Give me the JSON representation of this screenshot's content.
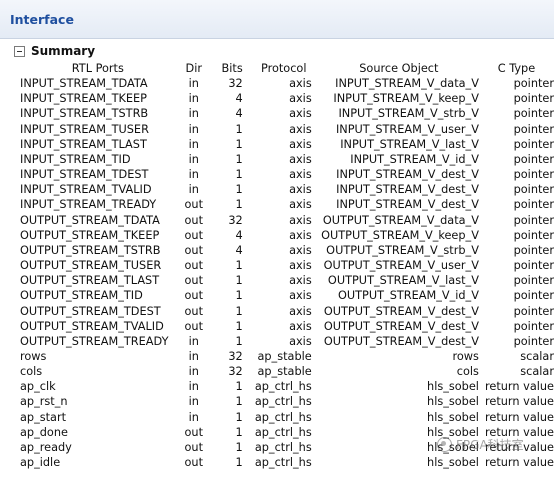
{
  "header": {
    "title": "Interface"
  },
  "summary": {
    "title": "Summary"
  },
  "table": {
    "columns": [
      "RTL Ports",
      "Dir",
      "Bits",
      "Protocol",
      "Source Object",
      "C Type"
    ],
    "rows": [
      [
        "INPUT_STREAM_TDATA",
        "in",
        "32",
        "axis",
        "INPUT_STREAM_V_data_V",
        "pointer"
      ],
      [
        "INPUT_STREAM_TKEEP",
        "in",
        "4",
        "axis",
        "INPUT_STREAM_V_keep_V",
        "pointer"
      ],
      [
        "INPUT_STREAM_TSTRB",
        "in",
        "4",
        "axis",
        "INPUT_STREAM_V_strb_V",
        "pointer"
      ],
      [
        "INPUT_STREAM_TUSER",
        "in",
        "1",
        "axis",
        "INPUT_STREAM_V_user_V",
        "pointer"
      ],
      [
        "INPUT_STREAM_TLAST",
        "in",
        "1",
        "axis",
        "INPUT_STREAM_V_last_V",
        "pointer"
      ],
      [
        "INPUT_STREAM_TID",
        "in",
        "1",
        "axis",
        "INPUT_STREAM_V_id_V",
        "pointer"
      ],
      [
        "INPUT_STREAM_TDEST",
        "in",
        "1",
        "axis",
        "INPUT_STREAM_V_dest_V",
        "pointer"
      ],
      [
        "INPUT_STREAM_TVALID",
        "in",
        "1",
        "axis",
        "INPUT_STREAM_V_dest_V",
        "pointer"
      ],
      [
        "INPUT_STREAM_TREADY",
        "out",
        "1",
        "axis",
        "INPUT_STREAM_V_dest_V",
        "pointer"
      ],
      [
        "OUTPUT_STREAM_TDATA",
        "out",
        "32",
        "axis",
        "OUTPUT_STREAM_V_data_V",
        "pointer"
      ],
      [
        "OUTPUT_STREAM_TKEEP",
        "out",
        "4",
        "axis",
        "OUTPUT_STREAM_V_keep_V",
        "pointer"
      ],
      [
        "OUTPUT_STREAM_TSTRB",
        "out",
        "4",
        "axis",
        "OUTPUT_STREAM_V_strb_V",
        "pointer"
      ],
      [
        "OUTPUT_STREAM_TUSER",
        "out",
        "1",
        "axis",
        "OUTPUT_STREAM_V_user_V",
        "pointer"
      ],
      [
        "OUTPUT_STREAM_TLAST",
        "out",
        "1",
        "axis",
        "OUTPUT_STREAM_V_last_V",
        "pointer"
      ],
      [
        "OUTPUT_STREAM_TID",
        "out",
        "1",
        "axis",
        "OUTPUT_STREAM_V_id_V",
        "pointer"
      ],
      [
        "OUTPUT_STREAM_TDEST",
        "out",
        "1",
        "axis",
        "OUTPUT_STREAM_V_dest_V",
        "pointer"
      ],
      [
        "OUTPUT_STREAM_TVALID",
        "out",
        "1",
        "axis",
        "OUTPUT_STREAM_V_dest_V",
        "pointer"
      ],
      [
        "OUTPUT_STREAM_TREADY",
        "in",
        "1",
        "axis",
        "OUTPUT_STREAM_V_dest_V",
        "pointer"
      ],
      [
        "rows",
        "in",
        "32",
        "ap_stable",
        "rows",
        "scalar"
      ],
      [
        "cols",
        "in",
        "32",
        "ap_stable",
        "cols",
        "scalar"
      ],
      [
        "ap_clk",
        "in",
        "1",
        "ap_ctrl_hs",
        "hls_sobel",
        "return value"
      ],
      [
        "ap_rst_n",
        "in",
        "1",
        "ap_ctrl_hs",
        "hls_sobel",
        "return value"
      ],
      [
        "ap_start",
        "in",
        "1",
        "ap_ctrl_hs",
        "hls_sobel",
        "return value"
      ],
      [
        "ap_done",
        "out",
        "1",
        "ap_ctrl_hs",
        "hls_sobel",
        "return value"
      ],
      [
        "ap_ready",
        "out",
        "1",
        "ap_ctrl_hs",
        "hls_sobel",
        "return value"
      ],
      [
        "ap_idle",
        "out",
        "1",
        "ap_ctrl_hs",
        "hls_sobel",
        "return value"
      ]
    ]
  },
  "watermark": {
    "text": "FPGA科技室",
    "icon": "wechat-icon"
  }
}
